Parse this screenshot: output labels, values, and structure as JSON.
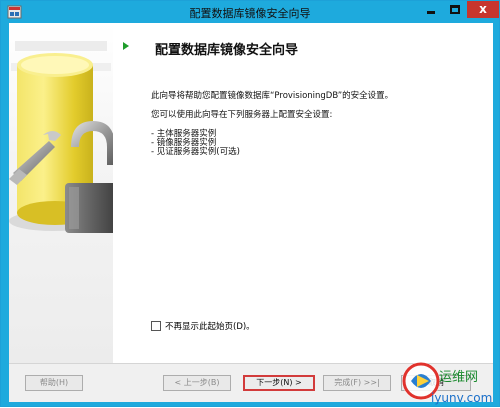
{
  "window": {
    "title": "配置数据库镜像安全向导"
  },
  "title_buttons": {
    "close": "x"
  },
  "header": {
    "title": "配置数据库镜像安全向导"
  },
  "body": {
    "line1": "此向导将帮助您配置镜像数据库“ProvisioningDB”的安全设置。",
    "line2": "您可以使用此向导在下列服务器上配置安全设置:",
    "bullets": [
      "- 主体服务器实例",
      "- 镜像服务器实例",
      "- 见证服务器实例(可选)"
    ]
  },
  "checkbox": {
    "label": "不再显示此起始页(D)。",
    "checked": false
  },
  "buttons": {
    "help": "帮助(H)",
    "prev": "< 上一步(B)",
    "next": "下一步(N) >",
    "finish": "完成(F) >>|",
    "cancel": "取消"
  },
  "watermark": {
    "text": "运维网",
    "subtext": "iyunv.com"
  },
  "colors": {
    "titlebar": "#1eaadd",
    "close": "#c7362e",
    "arrow": "#1f9d2b",
    "highlight": "#d23b3b"
  }
}
